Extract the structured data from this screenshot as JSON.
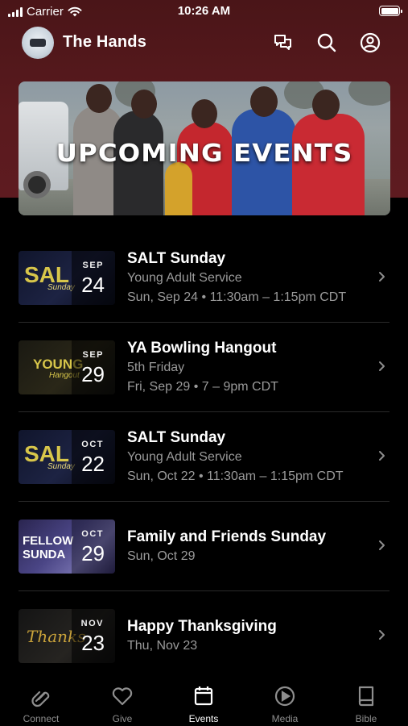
{
  "status_bar": {
    "carrier": "Carrier",
    "time": "10:26 AM"
  },
  "header": {
    "org_name": "The Hands",
    "icons": [
      "chat-bubbles-icon",
      "search-icon",
      "account-icon"
    ]
  },
  "banner": {
    "title": "UPCOMING EVENTS"
  },
  "events": [
    {
      "title": "SALT Sunday",
      "subtitle": "Young Adult Service",
      "when": "Sun, Sep 24 • 11:30am – 1:15pm CDT",
      "month": "SEP",
      "day": "24",
      "art_text": "SAL",
      "art_subtext": "Sunday"
    },
    {
      "title": "YA Bowling Hangout",
      "subtitle": "5th Friday",
      "when": "Fri, Sep 29 • 7 – 9pm CDT",
      "month": "SEP",
      "day": "29",
      "art_text": "YOUNG",
      "art_subtext": "Hangout"
    },
    {
      "title": "SALT Sunday",
      "subtitle": "Young Adult Service",
      "when": "Sun, Oct 22 • 11:30am – 1:15pm CDT",
      "month": "OCT",
      "day": "22",
      "art_text": "SAL",
      "art_subtext": "Sunday"
    },
    {
      "title": "Family and Friends Sunday",
      "subtitle": "",
      "when": "Sun, Oct 29",
      "month": "OCT",
      "day": "29",
      "art_text": "FELLOW",
      "art_subtext": "SUNDA"
    },
    {
      "title": "Happy Thanksgiving",
      "subtitle": "",
      "when": "Thu, Nov 23",
      "month": "NOV",
      "day": "23",
      "art_text": "Thanks",
      "art_subtext": ""
    }
  ],
  "tab_bar": {
    "tabs": [
      {
        "label": "Connect",
        "icon": "connect-icon",
        "active": false
      },
      {
        "label": "Give",
        "icon": "heart-icon",
        "active": false
      },
      {
        "label": "Events",
        "icon": "calendar-icon",
        "active": true
      },
      {
        "label": "Media",
        "icon": "play-icon",
        "active": false
      },
      {
        "label": "Bible",
        "icon": "book-icon",
        "active": false
      }
    ]
  },
  "colors": {
    "header_bg": "#5a1a1e",
    "background": "#000000",
    "secondary_text": "#9a9a9a",
    "inactive_tab": "#8e8e8e"
  }
}
